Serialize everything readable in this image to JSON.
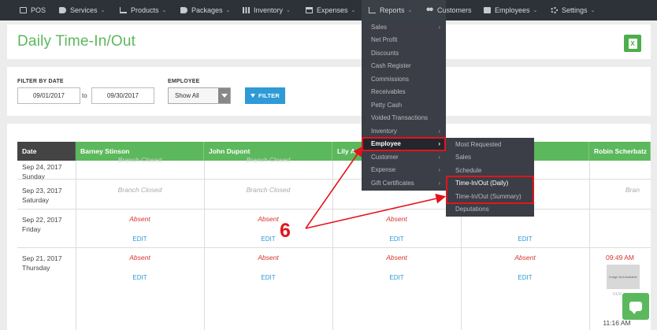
{
  "nav": {
    "items": [
      {
        "label": "POS",
        "icon": "monitor-icon",
        "chevron": ""
      },
      {
        "label": "Services",
        "icon": "tag-icon",
        "chevron": "⌄"
      },
      {
        "label": "Products",
        "icon": "cart-icon",
        "chevron": "⌄"
      },
      {
        "label": "Packages",
        "icon": "tags-icon",
        "chevron": "⌄"
      },
      {
        "label": "Inventory",
        "icon": "barcode-icon",
        "chevron": "⌄"
      },
      {
        "label": "Expenses",
        "icon": "credit-card-icon",
        "chevron": "⌄"
      },
      {
        "label": "Reports",
        "icon": "bar-chart-icon",
        "chevron": "⌄"
      },
      {
        "label": "Customers",
        "icon": "users-icon",
        "chevron": ""
      },
      {
        "label": "Employees",
        "icon": "briefcase-icon",
        "chevron": "⌄"
      },
      {
        "label": "Settings",
        "icon": "gear-icon",
        "chevron": "⌄"
      }
    ]
  },
  "page": {
    "title": "Daily Time-In/Out",
    "excel_label": "X"
  },
  "filter": {
    "date_label": "FILTER BY DATE",
    "date_from": "09/01/2017",
    "to_label": "to",
    "date_to": "09/30/2017",
    "employee_label": "EMPLOYEE",
    "employee_value": "Show All",
    "button_label": "FILTER"
  },
  "table": {
    "headers": [
      "Date",
      "Barney Stinson",
      "John Dupont",
      "Lily A",
      "",
      "",
      "Robin Scherbatz"
    ],
    "rows": [
      {
        "date": "Sep 24, 2017",
        "day": "Sunday"
      },
      {
        "date": "Sep 23, 2017",
        "day": "Saturday"
      },
      {
        "date": "Sep 22, 2017",
        "day": "Friday"
      },
      {
        "date": "Sep 21, 2017",
        "day": "Thursday"
      }
    ],
    "branch_closed": "Branch Closed",
    "branch_short": "Bran",
    "absent": "Absent",
    "edit": "EDIT",
    "time_in": "09:49 AM",
    "time_out": "11:16 AM",
    "no_image": "Image Not Available",
    "remark_faded": "REM"
  },
  "reports_menu": {
    "items": [
      {
        "label": "Sales",
        "sub": "›"
      },
      {
        "label": "Net Profit",
        "sub": ""
      },
      {
        "label": "Discounts",
        "sub": ""
      },
      {
        "label": "Cash Register",
        "sub": ""
      },
      {
        "label": "Commissions",
        "sub": ""
      },
      {
        "label": "Receivables",
        "sub": ""
      },
      {
        "label": "Petty Cash",
        "sub": ""
      },
      {
        "label": "Voided Transactions",
        "sub": ""
      },
      {
        "label": "Inventory",
        "sub": "›"
      },
      {
        "label": "Employee",
        "sub": "›"
      },
      {
        "label": "Customer",
        "sub": "›"
      },
      {
        "label": "Expense",
        "sub": "›"
      },
      {
        "label": "Gift Certificates",
        "sub": "›"
      }
    ]
  },
  "employee_submenu": {
    "items": [
      {
        "label": "Most Requested"
      },
      {
        "label": "Sales"
      },
      {
        "label": "Schedule"
      },
      {
        "label": "Time-In/Out (Daily)"
      },
      {
        "label": "Time-In/Out (Summary)"
      },
      {
        "label": "Deputations"
      }
    ]
  },
  "annotation": {
    "number": "6",
    "color": "#e3141b"
  },
  "colors": {
    "accent_green": "#5cb85c",
    "nav_bg": "#2d3238",
    "link_blue": "#2e9ad6",
    "absent_red": "#d9302a"
  }
}
